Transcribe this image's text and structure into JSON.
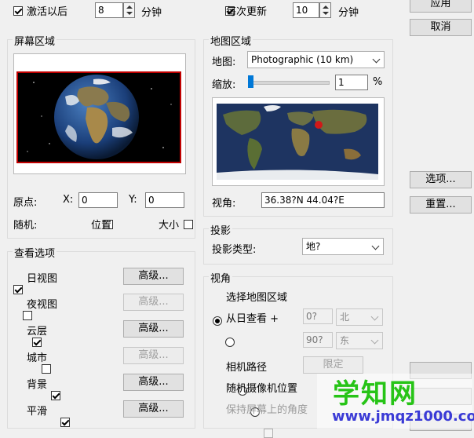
{
  "top": {
    "activate_after_label": "激活以后",
    "activate_after_value": "8",
    "activate_after_unit": "分钟",
    "update_every_label": "每次更新",
    "update_every_value": "10",
    "update_every_unit": "分钟"
  },
  "right_buttons": {
    "apply": "应用",
    "cancel": "取消",
    "options": "选项...",
    "reset": "重置..."
  },
  "screen_region": {
    "title": "屏幕区域",
    "origin_label": "原点:",
    "x_label": "X:",
    "x_value": "0",
    "y_label": "Y:",
    "y_value": "0",
    "random_label": "随机:",
    "position_label": "位置",
    "size_label": "大小"
  },
  "map_region": {
    "title": "地图区域",
    "map_label": "地图:",
    "map_value": "Photographic (10 km)",
    "zoom_label": "缩放:",
    "zoom_value": "1",
    "zoom_unit": "%",
    "view_label": "视角:",
    "view_value": "36.38?N   44.04?E"
  },
  "view_options": {
    "title": "查看选项",
    "advanced_label": "高级...",
    "items": [
      {
        "label": "日视图",
        "checked": true,
        "advanced_enabled": true
      },
      {
        "label": "夜视图",
        "checked": false,
        "advanced_enabled": false
      },
      {
        "label": "云层",
        "checked": true,
        "advanced_enabled": true
      },
      {
        "label": "城市",
        "checked": false,
        "advanced_enabled": false
      },
      {
        "label": "背景",
        "checked": true,
        "advanced_enabled": true
      },
      {
        "label": "平滑",
        "checked": true,
        "advanced_enabled": true
      }
    ]
  },
  "projection": {
    "title": "投影",
    "type_label": "投影类型:",
    "type_value": "地?"
  },
  "viewpoint": {
    "title": "视角",
    "select_map_region": "选择地图区域",
    "from_sun": "从日查看 +",
    "lat_value": "0?",
    "lat_dir": "北",
    "lon_value": "90?",
    "lon_dir": "东",
    "camera_path": "相机路径",
    "camera_path_button": "限定",
    "random_camera": "随机摄像机位置",
    "keep_screen": "保持屏幕上的角度"
  },
  "watermark": {
    "main": "学知网",
    "sub": "www.jmqz1000.com"
  }
}
